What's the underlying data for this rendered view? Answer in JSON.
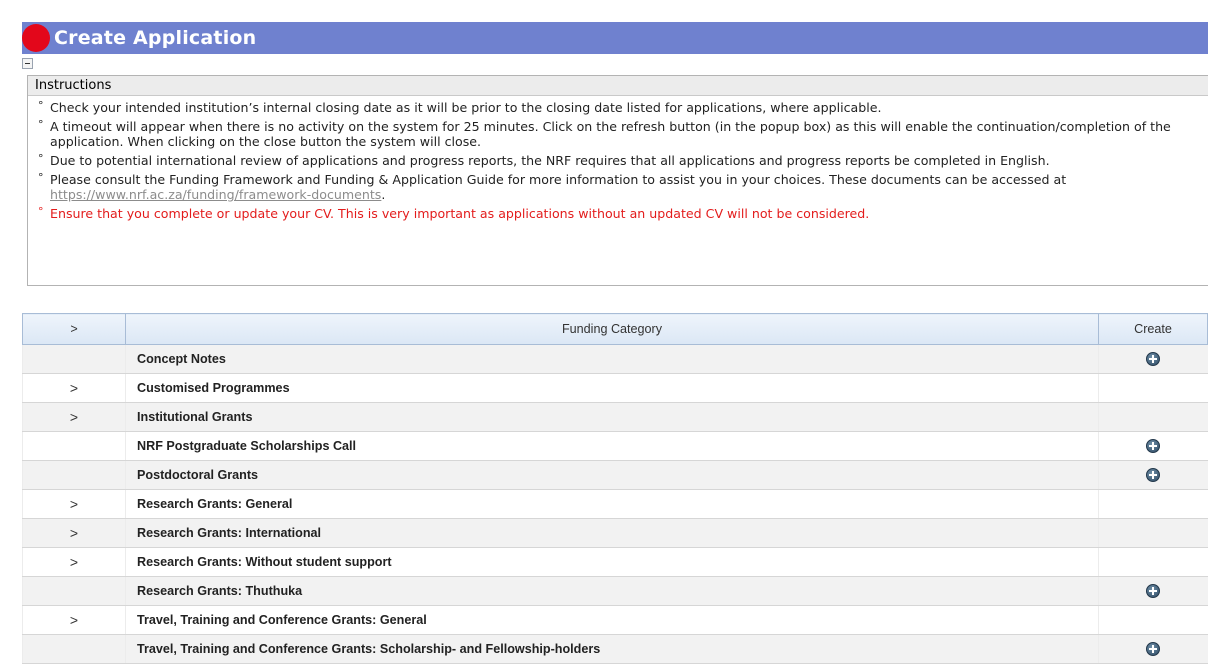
{
  "header": {
    "title": "Create Application",
    "brand_color": "#6f81cf",
    "dot_color": "#e3071b"
  },
  "instructions": {
    "heading": "Instructions",
    "items": [
      {
        "text": "Check your intended institution’s internal closing date as it will be prior to the closing date listed for applications, where applicable."
      },
      {
        "text": "A timeout will appear when there is no activity on the system for 25 minutes. Click on the refresh button (in the popup box) as this will enable the continuation/completion of the application. When clicking on the close button the system will close."
      },
      {
        "text": "Due to potential international review of applications and progress reports, the NRF requires that all applications and progress reports be completed in English."
      },
      {
        "text_before": "Please consult the Funding Framework and Funding & Application Guide for more information to assist you in your choices. These documents can be accessed at ",
        "link": "https://www.nrf.ac.za/funding/framework-documents",
        "text_after": "."
      },
      {
        "text": "Ensure that you complete or update your CV. This is very important as applications without an updated CV will not be considered."
      }
    ]
  },
  "table": {
    "headers": {
      "expand": ">",
      "category": "Funding Category",
      "create": "Create"
    },
    "rows": [
      {
        "expand": "",
        "name": "Concept Notes",
        "create": true
      },
      {
        "expand": ">",
        "name": "Customised Programmes",
        "create": false
      },
      {
        "expand": ">",
        "name": "Institutional Grants",
        "create": false
      },
      {
        "expand": "",
        "name": "NRF Postgraduate Scholarships Call",
        "create": true
      },
      {
        "expand": "",
        "name": "Postdoctoral Grants",
        "create": true
      },
      {
        "expand": ">",
        "name": "Research Grants: General",
        "create": false
      },
      {
        "expand": ">",
        "name": "Research Grants: International",
        "create": false
      },
      {
        "expand": ">",
        "name": "Research Grants: Without student support",
        "create": false
      },
      {
        "expand": "",
        "name": "Research Grants: Thuthuka",
        "create": true
      },
      {
        "expand": ">",
        "name": "Travel, Training and Conference Grants: General",
        "create": false
      },
      {
        "expand": "",
        "name": "Travel, Training and Conference Grants: Scholarship- and Fellowship-holders",
        "create": true
      }
    ]
  }
}
